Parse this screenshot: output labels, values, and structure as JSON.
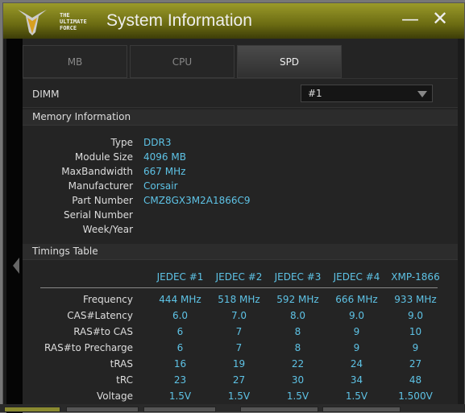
{
  "window": {
    "title": "System Information",
    "logo_text": [
      "THE",
      "ULTIMATE",
      "FORCE"
    ],
    "minimize": "—",
    "close": "✕"
  },
  "tabs": [
    {
      "label": "MB",
      "active": false
    },
    {
      "label": "CPU",
      "active": false
    },
    {
      "label": "SPD",
      "active": true
    }
  ],
  "dimm": {
    "label": "DIMM",
    "value": "#1"
  },
  "memory": {
    "header": "Memory Information",
    "fields": [
      {
        "k": "Type",
        "v": "DDR3"
      },
      {
        "k": "Module Size",
        "v": "4096 MB"
      },
      {
        "k": "MaxBandwidth",
        "v": "667 MHz"
      },
      {
        "k": "Manufacturer",
        "v": "Corsair"
      },
      {
        "k": "Part Number",
        "v": "CMZ8GX3M2A1866C9"
      },
      {
        "k": "Serial Number",
        "v": ""
      },
      {
        "k": "Week/Year",
        "v": ""
      }
    ]
  },
  "timings": {
    "header": "Timings Table",
    "columns": [
      "JEDEC #1",
      "JEDEC #2",
      "JEDEC #3",
      "JEDEC #4",
      "XMP-1866"
    ],
    "rows": [
      {
        "label": "Frequency",
        "values": [
          "444 MHz",
          "518 MHz",
          "592 MHz",
          "666 MHz",
          "933 MHz"
        ]
      },
      {
        "label": "CAS#Latency",
        "values": [
          "6.0",
          "7.0",
          "8.0",
          "9.0",
          "9.0"
        ]
      },
      {
        "label": "RAS#to CAS",
        "values": [
          "6",
          "7",
          "8",
          "9",
          "10"
        ]
      },
      {
        "label": "RAS#to Precharge",
        "values": [
          "6",
          "7",
          "8",
          "9",
          "9"
        ]
      },
      {
        "label": "tRAS",
        "values": [
          "16",
          "19",
          "22",
          "24",
          "27"
        ]
      },
      {
        "label": "tRC",
        "values": [
          "23",
          "27",
          "30",
          "34",
          "48"
        ]
      },
      {
        "label": "Voltage",
        "values": [
          "1.5V",
          "1.5V",
          "1.5V",
          "1.5V",
          "1.500V"
        ]
      }
    ]
  },
  "colors": {
    "value": "#5ec3e6",
    "title_bar": "#8a8a20"
  }
}
